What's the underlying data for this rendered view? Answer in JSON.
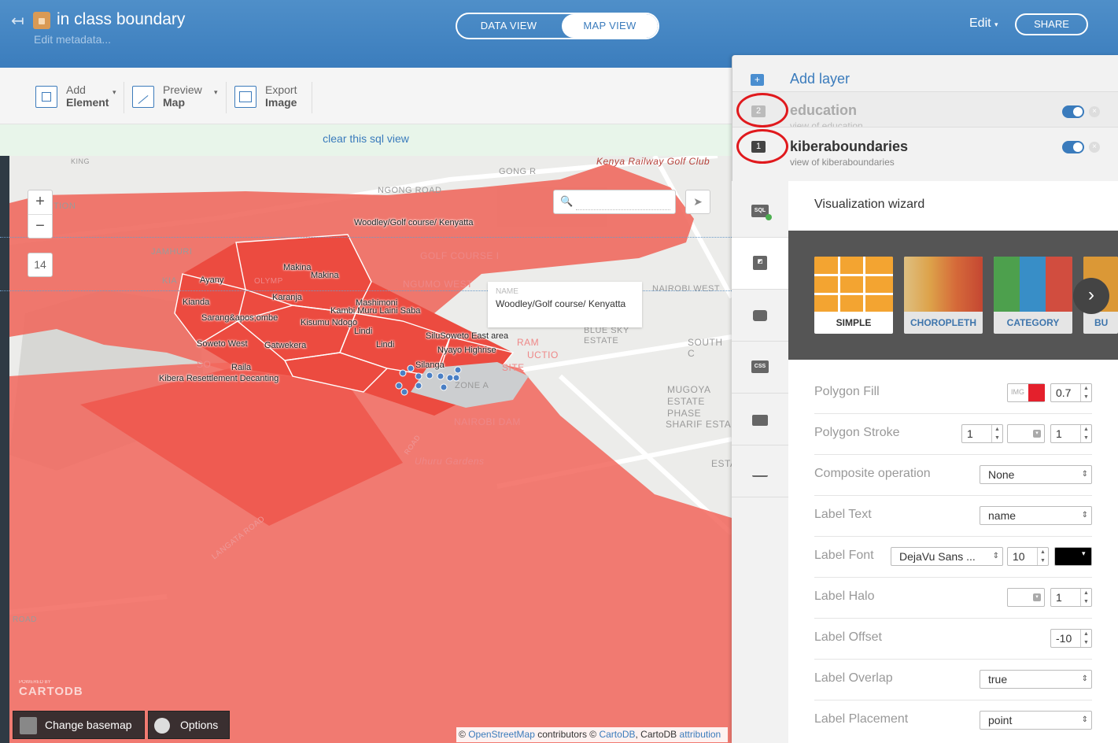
{
  "header": {
    "title": "in class boundary",
    "metadata_link": "Edit metadata...",
    "view_toggle": {
      "data_view": "DATA VIEW",
      "map_view": "MAP VIEW",
      "active": "MAP VIEW"
    },
    "edit_label": "Edit",
    "share_label": "SHARE"
  },
  "toolbar": {
    "add_element": {
      "line1": "Add",
      "line2": "Element"
    },
    "preview_map": {
      "line1": "Preview",
      "line2": "Map"
    },
    "export_image": {
      "line1": "Export",
      "line2": "Image"
    }
  },
  "sql_bar": {
    "link": "clear this sql view"
  },
  "map": {
    "zoom_in": "+",
    "zoom_out": "−",
    "zoom_level": "14",
    "popup": {
      "key": "NAME",
      "value": "Woodley/Golf course/ Kenyatta"
    },
    "base_labels": [
      "Kenya Railway Golf Club",
      "NGONG ROAD",
      "GONG R",
      "KING",
      "TION",
      "JAMHURI",
      "KIA",
      "GOLF COURSE I",
      "NGUMO WEST",
      "NAIROBI WEST",
      "BLUE SKY ESTATE",
      "SOUTH C",
      "MUGOYA ESTATE PHASE",
      "SHARIF ESTA",
      "NAIROBI DAM",
      "Uhuru Gardens",
      "LANGATA ROAD",
      "ROAD",
      "ZONE A",
      "SO",
      "RAM",
      "UCTIO",
      "SITE",
      "OLYMP",
      "ROAD",
      "ESTA"
    ],
    "polygon_labels": [
      "Woodley/Golf course/ Kenyatta",
      "Makina",
      "Makina",
      "Ayany",
      "Karanja",
      "Kianda",
      "Mashimoni",
      "Kambi Muru Laini Saba",
      "Sarang&apos;ombe",
      "Kisumu Ndogo",
      "Lindi",
      "Soweto West",
      "Gatwekera",
      "Lindi",
      "SiluSoweto East area",
      "Nyayo Highrise",
      "Raila",
      "Silanga",
      "Kibera Resettlement Decanting"
    ],
    "powered_by": "POWERED BY",
    "logo": "CARTODB",
    "change_basemap": "Change basemap",
    "options": "Options",
    "attribution": {
      "prefix": "©",
      "osm": "OpenStreetMap",
      "mid": "contributors ©",
      "cartodb": "CartoDB",
      "sep": ", CartoDB",
      "attr": "attribution"
    }
  },
  "layers_panel": {
    "add_layer": "Add layer",
    "layers": [
      {
        "num": "2",
        "name": "education",
        "subtitle": "view of education",
        "visible": true
      },
      {
        "num": "1",
        "name": "kiberaboundaries",
        "subtitle": "view of kiberaboundaries",
        "visible": true
      }
    ]
  },
  "sidebar": {
    "icons": [
      {
        "name": "sql-icon",
        "glyph": "SQL"
      },
      {
        "name": "wizard-icon",
        "glyph": "◩"
      },
      {
        "name": "infowindow-icon",
        "glyph": ""
      },
      {
        "name": "css-icon",
        "glyph": "CSS"
      },
      {
        "name": "legend-icon",
        "glyph": ""
      },
      {
        "name": "filter-icon",
        "glyph": ""
      }
    ]
  },
  "wizard": {
    "title": "Visualization wizard",
    "types": [
      "SIMPLE",
      "CHOROPLETH",
      "CATEGORY",
      "BU"
    ],
    "selected": "SIMPLE",
    "rows": [
      {
        "label": "Polygon Fill",
        "img": "IMG",
        "color": "#e4202c",
        "value": "0.7"
      },
      {
        "label": "Polygon Stroke",
        "width": "1",
        "opacity": "1"
      },
      {
        "label": "Composite operation",
        "value": "None"
      },
      {
        "label": "Label Text",
        "value": "name"
      },
      {
        "label": "Label Font",
        "font": "DejaVu Sans ...",
        "size": "10",
        "color": "#000000"
      },
      {
        "label": "Label Halo",
        "value": "1"
      },
      {
        "label": "Label Offset",
        "value": "-10"
      },
      {
        "label": "Label Overlap",
        "value": "true"
      },
      {
        "label": "Label Placement",
        "value": "point"
      }
    ]
  }
}
